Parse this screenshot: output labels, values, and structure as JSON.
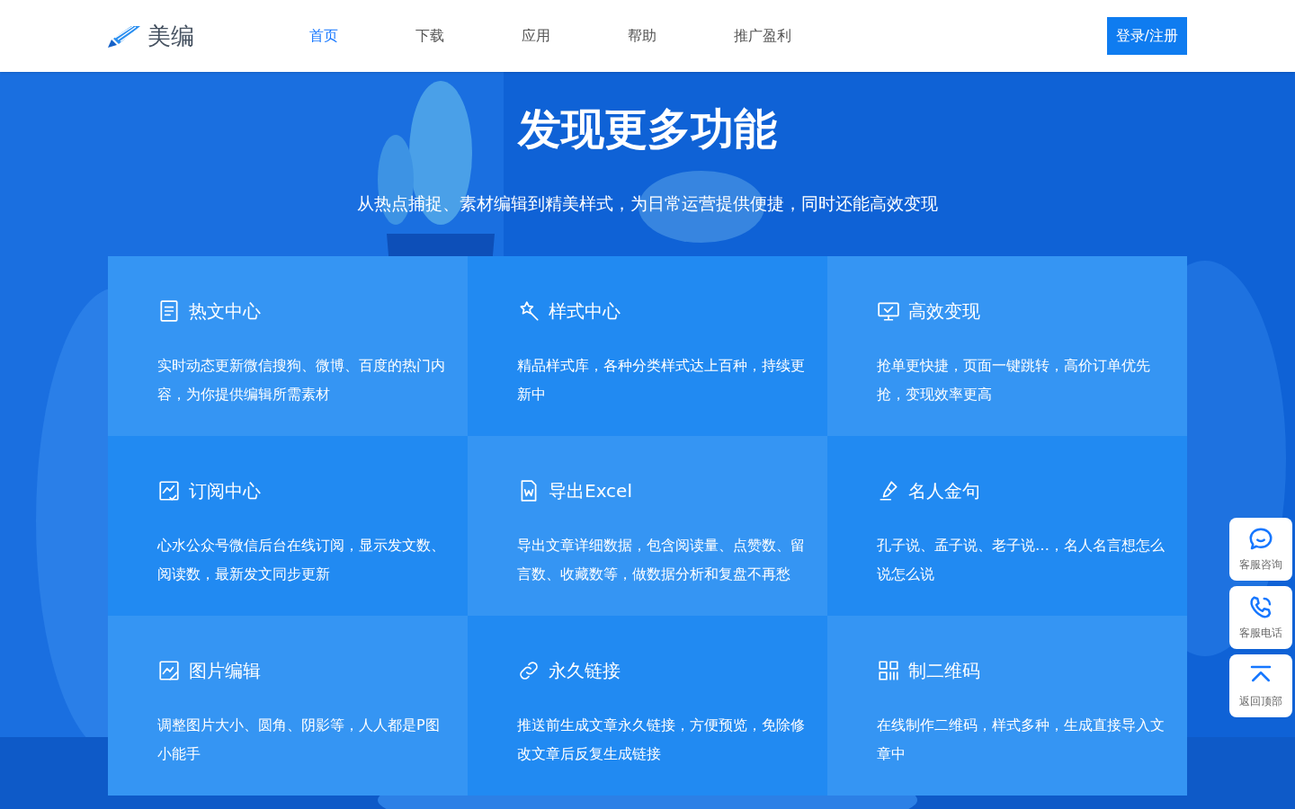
{
  "header": {
    "logo": "美编",
    "nav": [
      {
        "label": "首页",
        "selected": true
      },
      {
        "label": "下载",
        "selected": false
      },
      {
        "label": "应用",
        "selected": false
      },
      {
        "label": "帮助",
        "selected": false
      },
      {
        "label": "推广盈利",
        "selected": false
      }
    ],
    "login_button": "登录/注册"
  },
  "hero": {
    "kind": "picture",
    "title": "发现更多功能",
    "subtitle": "从热点捕捉、素材编辑到精美样式，为日常运营提供便捷，同时还能高效变现"
  },
  "features": [
    {
      "kind": "light",
      "title": "热文中心",
      "text": "实时动态更新微信搜狗、微博、百度的热门内容，为你提供编辑所需素材"
    },
    {
      "kind": "dark",
      "title": "样式中心",
      "text": "精品样式库，各种分类样式达上百种，持续更新中"
    },
    {
      "kind": "light",
      "title": "高效变现",
      "text": "抢单更快捷，页面一键跳转，高价订单优先抢，变现效率更高"
    },
    {
      "kind": "dark",
      "title": "订阅中心",
      "text": "心水公众号微信后台在线订阅，显示发文数、阅读数，最新发文同步更新"
    },
    {
      "kind": "light",
      "title": "导出Excel",
      "text": "导出文章详细数据，包含阅读量、点赞数、留言数、收藏数等，做数据分析和复盘不再愁"
    },
    {
      "kind": "dark",
      "title": "名人金句",
      "text": "孔子说、孟子说、老子说…，名人名言想怎么说怎么说"
    },
    {
      "kind": "light",
      "title": "图片编辑",
      "text": "调整图片大小、圆角、阴影等，人人都是P图小能手"
    },
    {
      "kind": "dark",
      "title": "永久链接",
      "text": "推送前生成文章永久链接，方便预览，免除修改文章后反复生成链接"
    },
    {
      "kind": "light",
      "title": "制二维码",
      "text": "在线制作二维码，样式多种，生成直接导入文章中"
    }
  ],
  "side_buttons": [
    "客服咨询",
    "客服电话",
    "返回顶部"
  ]
}
